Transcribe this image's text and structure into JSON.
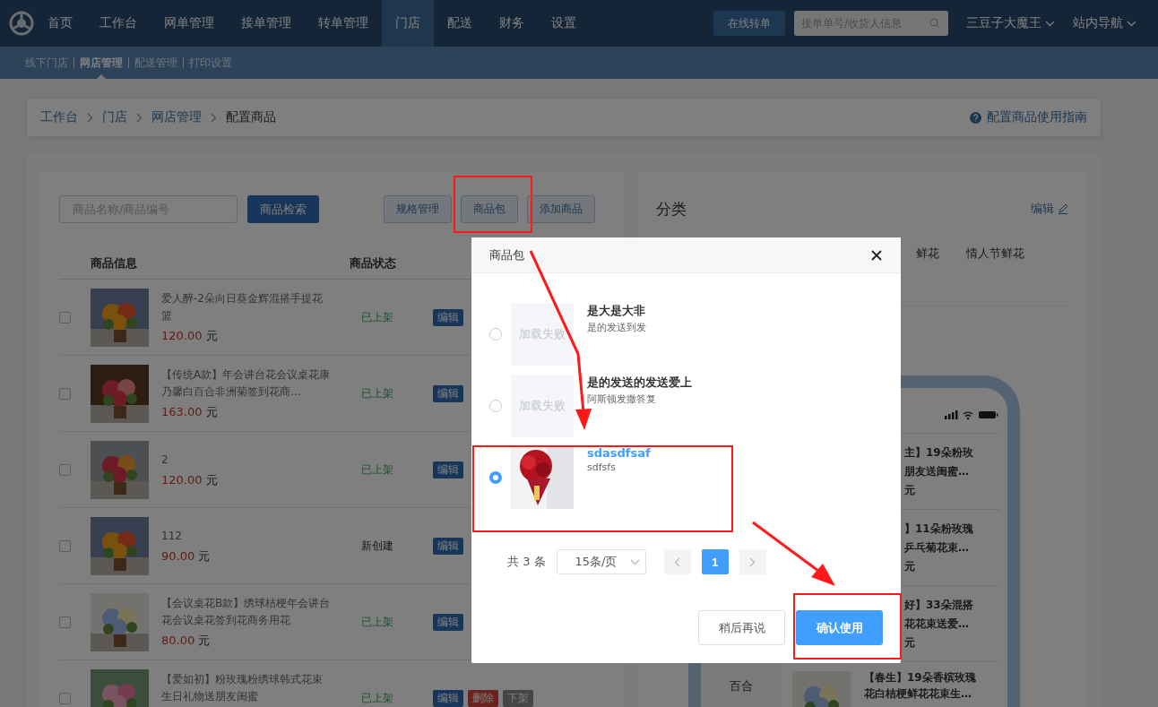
{
  "nav": {
    "items": [
      {
        "label": "首页",
        "selected": false
      },
      {
        "label": "工作台",
        "selected": false
      },
      {
        "label": "网单管理",
        "selected": false
      },
      {
        "label": "接单管理",
        "selected": false
      },
      {
        "label": "转单管理",
        "selected": false
      },
      {
        "label": "门店",
        "selected": true
      },
      {
        "label": "配送",
        "selected": false
      },
      {
        "label": "财务",
        "selected": false
      },
      {
        "label": "设置",
        "selected": false
      }
    ],
    "transfer_button": "在线转单",
    "search": {
      "placeholder": "接单单号/收货人信息"
    },
    "user": "三豆子大魔王",
    "site_nav": "站内导航"
  },
  "subnav": [
    {
      "label": "线下门店",
      "selected": false
    },
    {
      "label": "网店管理",
      "selected": true
    },
    {
      "label": "配送管理",
      "selected": false
    },
    {
      "label": "打印设置",
      "selected": false
    }
  ],
  "breadcrumb": {
    "items": [
      "工作台",
      "门店",
      "网店管理"
    ],
    "current": "配置商品",
    "help": "配置商品使用指南"
  },
  "products": {
    "search": {
      "placeholder": "商品名称/商品编号"
    },
    "search_button": "商品检索",
    "toolbar": [
      "规格管理",
      "商品包",
      "添加商品"
    ],
    "columns": [
      "商品信息",
      "商品状态"
    ],
    "rows": [
      {
        "title": "爱人醉-2朵向日葵金辉混搭手提花篮",
        "price": "120.00",
        "unit": "元",
        "status": "已上架",
        "kind": "listed",
        "checked": false,
        "actions": [
          {
            "label": "编辑",
            "kind": "edit"
          }
        ]
      },
      {
        "title": "【传统A款】年会讲台花会议桌花康乃馨白百合非洲菊签到花商…",
        "price": "163.00",
        "unit": "元",
        "status": "已上架",
        "kind": "listed",
        "checked": false,
        "actions": [
          {
            "label": "编辑",
            "kind": "edit"
          }
        ]
      },
      {
        "title": "2",
        "price": "120.00",
        "unit": "元",
        "status": "已上架",
        "kind": "listed",
        "checked": false,
        "actions": [
          {
            "label": "编辑",
            "kind": "edit"
          }
        ]
      },
      {
        "title": "112",
        "price": "90.00",
        "unit": "元",
        "status": "新创建",
        "kind": "new",
        "checked": false,
        "actions": [
          {
            "label": "编辑",
            "kind": "edit"
          }
        ]
      },
      {
        "title": "【会议桌花B款】绣球桔梗年会讲台花会议桌花签到花商务用花",
        "price": "80.00",
        "unit": "元",
        "status": "已上架",
        "kind": "listed",
        "checked": false,
        "actions": [
          {
            "label": "编辑",
            "kind": "edit"
          }
        ]
      },
      {
        "title": "【爱如初】粉玫瑰粉绣球韩式花束生日礼物送朋友闺蜜",
        "status": "已上架",
        "kind": "listed",
        "checked": false,
        "actions": [
          {
            "label": "编辑",
            "kind": "edit"
          },
          {
            "label": "删除",
            "kind": "delete"
          },
          {
            "label": "下架",
            "kind": "unlist"
          }
        ]
      }
    ]
  },
  "category": {
    "title": "分类",
    "edit": "编辑",
    "tabs": [
      "鲜花",
      "情人节鲜花"
    ],
    "preview": {
      "side": [
        "百合"
      ],
      "items": [
        {
          "kind": "partial",
          "lines": [
            "主】19朵粉玫",
            "朋友送闺蜜…",
            "元"
          ]
        },
        {
          "kind": "partial",
          "lines": [
            "】11朵粉玫瑰",
            "乒乓菊花束…",
            "元"
          ]
        },
        {
          "kind": "partial",
          "lines": [
            "好】33朵混搭",
            "花花束送爱…",
            "元"
          ]
        },
        {
          "kind": "full",
          "lines": [
            "【春生】19朵香槟玫瑰",
            "花白桔梗鲜花花束生…"
          ]
        }
      ]
    }
  },
  "dialog": {
    "title": "商品包",
    "items": [
      {
        "title": "是大是大非",
        "subtitle": "是的发送到发",
        "selected": false,
        "image": {
          "kind": "failed",
          "text": "加载失败"
        }
      },
      {
        "title": "是的发送的发送爱上",
        "subtitle": "阿斯顿发撒答复",
        "selected": false,
        "image": {
          "kind": "failed",
          "text": "加载失败"
        }
      },
      {
        "title": "sdasdfsaf",
        "subtitle": "sdfsfs",
        "selected": true
      }
    ],
    "pagination": {
      "total": "共 3 条",
      "page_size": "15条/页",
      "pages": [
        {
          "label": "1",
          "selected": true
        }
      ]
    },
    "cancel": "稍后再说",
    "confirm": "确认使用"
  }
}
